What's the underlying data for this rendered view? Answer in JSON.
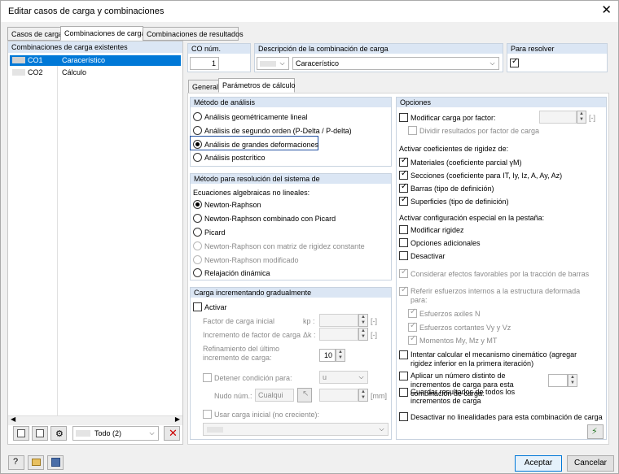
{
  "window": {
    "title": "Editar casos de carga y combinaciones"
  },
  "main_tabs": [
    "Casos de carga",
    "Combinaciones de carga",
    "Combinaciones de resultados"
  ],
  "left": {
    "header": "Combinaciones de carga existentes",
    "rows": [
      {
        "id": "CO1",
        "name": "Caracerístico"
      },
      {
        "id": "CO2",
        "name": "Cálculo"
      }
    ],
    "filter_value": "Todo (2)"
  },
  "top": {
    "co_num_label": "CO núm.",
    "co_num_value": "1",
    "desc_label": "Descripción de la combinación de carga",
    "desc_value": "Caracerístico",
    "resolve_label": "Para resolver"
  },
  "sub_tabs": [
    "General",
    "Parámetros de cálculo"
  ],
  "analysis": {
    "header": "Método de análisis",
    "options": [
      "Análisis geométricamente lineal",
      "Análisis de segundo orden (P-Delta / P-delta)",
      "Análisis de grandes deformaciones",
      "Análisis postcrítico"
    ]
  },
  "solver": {
    "header": "Método para resolución del sistema de",
    "subtitle": "Ecuaciones algebraicas no lineales:",
    "options": [
      "Newton-Raphson",
      "Newton-Raphson combinado con Picard",
      "Picard",
      "Newton-Raphson con matriz de rigidez constante",
      "Newton-Raphson modificado",
      "Relajación dinámica"
    ]
  },
  "incremental": {
    "header": "Carga incrementando gradualmente",
    "activate": "Activar",
    "factor_initial": "Factor de carga inicial",
    "factor_initial_sym": "kp :",
    "factor_increment": "Incremento de factor de carga",
    "factor_increment_sym": "Δk :",
    "unit_empty": "[-]",
    "refine_label": "Refinamiento del último incremento de carga:",
    "refine_value": "10",
    "stop_condition": "Detener condición para:",
    "stop_value": "u",
    "node_label": "Nudo núm.:",
    "node_value": "Cualqui",
    "unit_mm": "[mm]",
    "initial_load": "Usar carga inicial (no creciente):"
  },
  "options": {
    "header": "Opciones",
    "modify_load": "Modificar carga por factor:",
    "divide_results": "Dividir resultados por factor de carga",
    "unit_empty": "[-]",
    "stiffness_title": "Activar coeficientes de rigidez de:",
    "materials": "Materiales (coeficiente parcial γM)",
    "sections": "Secciones (coeficiente para IT, Iy, Iz, A, Ay, Az)",
    "bars": "Barras (tipo de definición)",
    "surfaces": "Superficies (tipo de definición)",
    "special_title": "Activar configuración especial en la pestaña:",
    "modify_stiffness": "Modificar rigidez",
    "additional_options": "Opciones adicionales",
    "deactivate": "Desactivar",
    "favorable_effects": "Considerar efectos favorables por la tracción de barras",
    "refer_forces": "Referir esfuerzos internos a la estructura deformada para:",
    "axial": "Esfuerzos axiles N",
    "shear": "Esfuerzos cortantes Vy y Vz",
    "moments": "Momentos My, Mz y MT",
    "mechanism": "Intentar calcular el mecanismo cinemático (agregar rigidez inferior en la primera iteración)",
    "different_increments": "Aplicar un número distinto de incrementos de carga para esta combinación de carga:",
    "save_results": "Guardar resultados de todos los incrementos de carga",
    "deactivate_nonlinear": "Desactivar no linealidades para esta combinación de carga"
  },
  "footer": {
    "ok": "Aceptar",
    "cancel": "Cancelar"
  }
}
